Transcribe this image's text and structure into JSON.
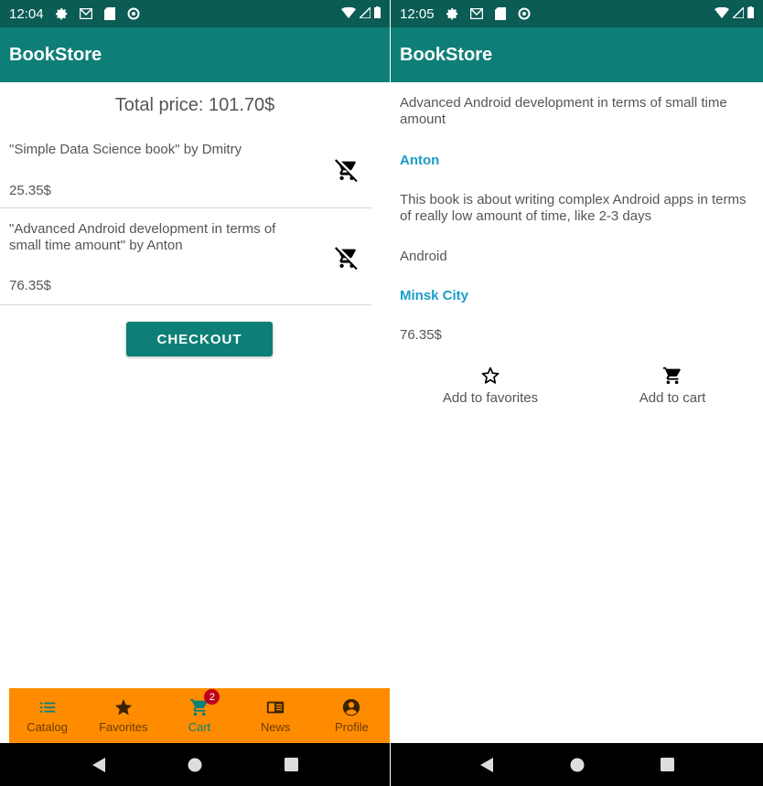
{
  "left_screen": {
    "status": {
      "time": "12:04"
    },
    "app_title": "BookStore",
    "total_price": "Total price: 101.70$",
    "cart_items": [
      {
        "title": "\"Simple Data Science book\" by Dmitry",
        "price": "25.35$"
      },
      {
        "title": "\"Advanced Android development in terms of small time amount\" by Anton",
        "price": "76.35$"
      }
    ],
    "checkout_label": "CHECKOUT",
    "bottom_nav": [
      {
        "label": "Catalog",
        "icon": "list-icon"
      },
      {
        "label": "Favorites",
        "icon": "star-icon"
      },
      {
        "label": "Cart",
        "icon": "cart-icon",
        "badge": "2",
        "active": true
      },
      {
        "label": "News",
        "icon": "newspaper-icon"
      },
      {
        "label": "Profile",
        "icon": "account-icon"
      }
    ],
    "colors": {
      "primary": "#0e7f77",
      "status_bar": "#0b5c55",
      "nav_bg": "#ff8c00",
      "badge": "#c0001b"
    }
  },
  "right_screen": {
    "status": {
      "time": "12:05"
    },
    "app_title": "BookStore",
    "book_title": "Advanced Android development in terms of small time amount",
    "author": "Anton",
    "description": "This book is about writing complex Android apps in terms of really low amount of time, like 2-3 days",
    "genre": "Android",
    "city": "Minsk City",
    "price": "76.35$",
    "actions": [
      {
        "label": "Add to favorites",
        "icon": "star-outline-icon"
      },
      {
        "label": "Add to cart",
        "icon": "cart-icon"
      }
    ],
    "colors": {
      "link": "#1a9ec9"
    }
  }
}
